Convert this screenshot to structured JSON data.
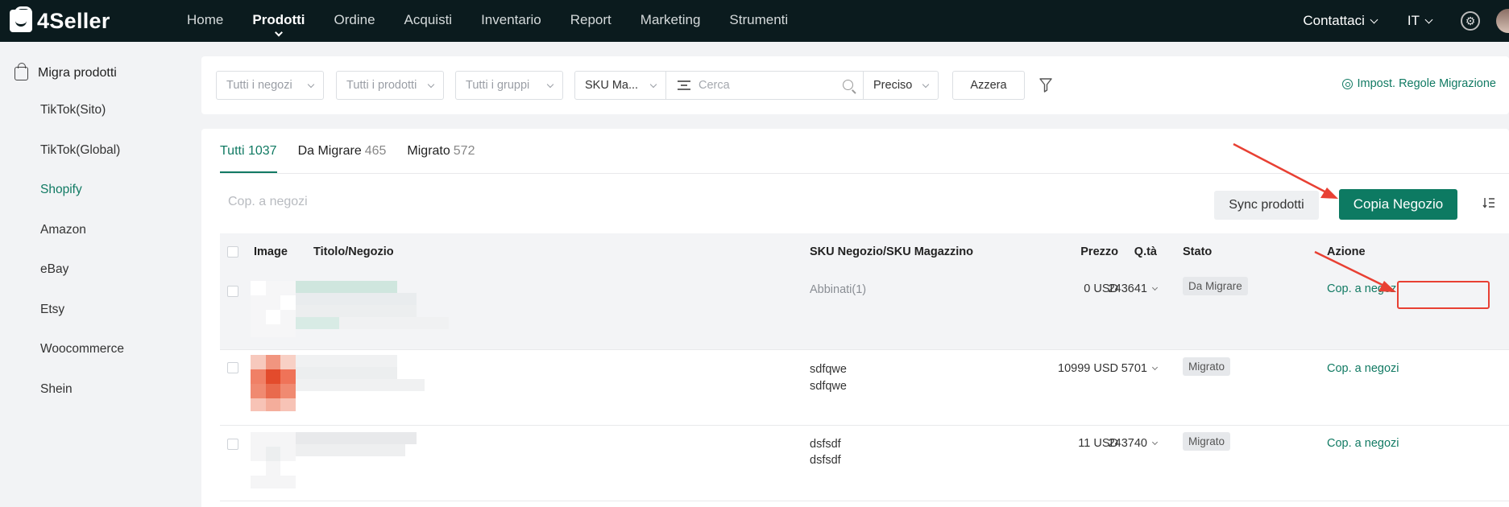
{
  "app": {
    "brand": "4Seller",
    "nav": [
      "Home",
      "Prodotti",
      "Ordine",
      "Acquisti",
      "Inventario",
      "Report",
      "Marketing",
      "Strumenti"
    ],
    "active_nav": "Prodotti",
    "contact": "Contattaci",
    "language": "IT"
  },
  "sidebar": {
    "header": "Migra prodotti",
    "items": [
      "TikTok(Sito)",
      "TikTok(Global)",
      "Shopify",
      "Amazon",
      "eBay",
      "Etsy",
      "Woocommerce",
      "Shein"
    ],
    "active": "Shopify"
  },
  "filters": {
    "stores": "Tutti i negozi",
    "products": "Tutti i prodotti",
    "groups": "Tutti i gruppi",
    "sku_type": "SKU Ma...",
    "search_placeholder": "Cerca",
    "match": "Preciso",
    "reset": "Azzera",
    "rules": "Impost. Regole Migrazione"
  },
  "tabs": [
    {
      "label": "Tutti",
      "count": "1037"
    },
    {
      "label": "Da Migrare",
      "count": "465"
    },
    {
      "label": "Migrato",
      "count": "572"
    }
  ],
  "toolbar": {
    "bulk_copy": "Cop. a negozi",
    "sync": "Sync prodotti",
    "copy_store": "Copia Negozio"
  },
  "table": {
    "headers": {
      "image": "Image",
      "title": "Titolo/Negozio",
      "sku": "SKU Negozio/SKU Magazzino",
      "price": "Prezzo",
      "qty": "Q.tà",
      "status": "Stato",
      "action": "Azione"
    },
    "rows": [
      {
        "sku_line1": "Abbinati(1)",
        "sku_line2": "",
        "price": "0 USD",
        "qty": "243641",
        "status": "Da Migrare",
        "action": "Cop. a negozi"
      },
      {
        "sku_line1": "sdfqwe",
        "sku_line2": "sdfqwe",
        "price": "10999 USD",
        "qty": "5701",
        "status": "Migrato",
        "action": "Cop. a negozi"
      },
      {
        "sku_line1": "dsfsdf",
        "sku_line2": "dsfsdf",
        "price": "11 USD",
        "qty": "243740",
        "status": "Migrato",
        "action": "Cop. a negozi"
      }
    ]
  },
  "colors": {
    "topbar": "#0b1b1e",
    "accent": "#117a63",
    "primary_button": "#0d7a62",
    "annotation": "#e84033"
  }
}
